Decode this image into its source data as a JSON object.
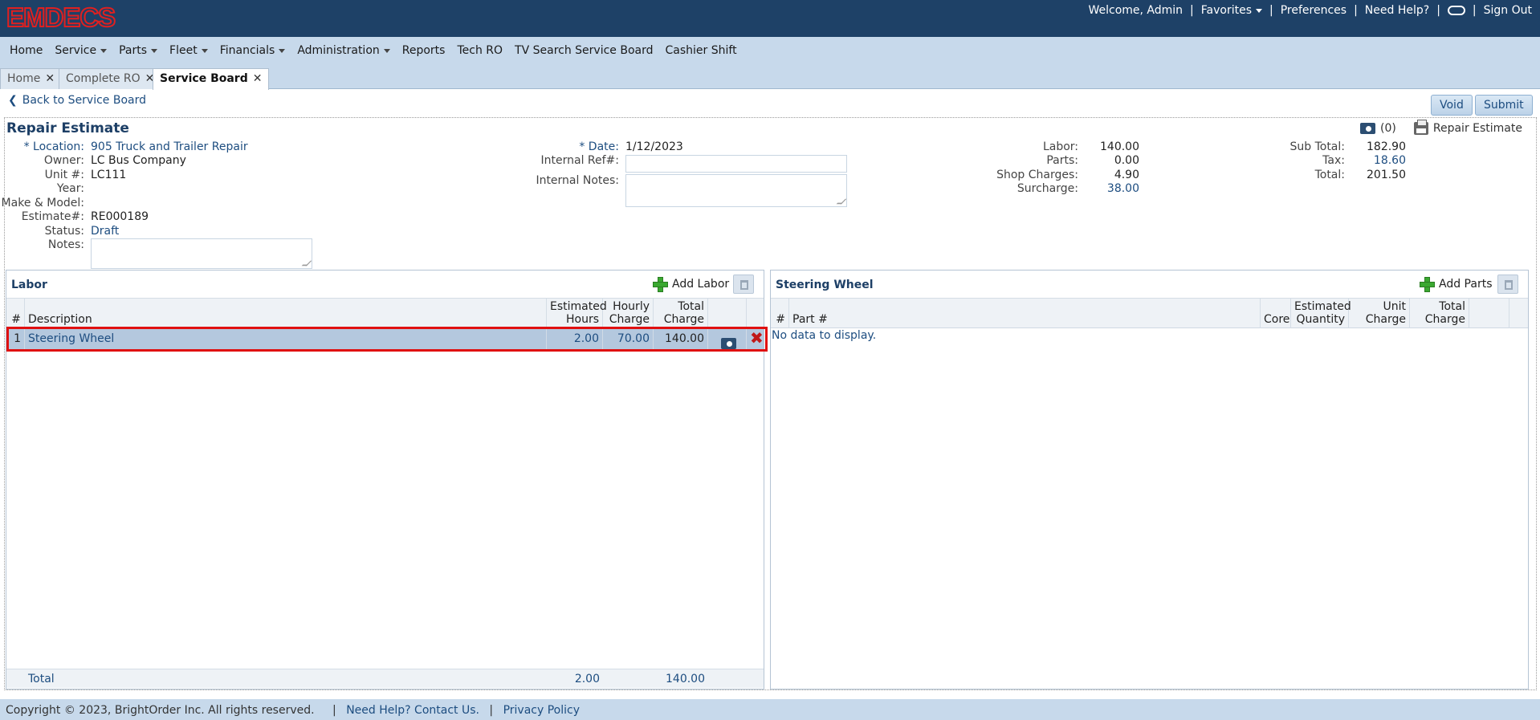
{
  "app": {
    "logo": "EMDECS"
  },
  "topbar": {
    "welcome": "Welcome, Admin",
    "favorites": "Favorites",
    "preferences": "Preferences",
    "need_help": "Need Help?",
    "sign_out": "Sign Out",
    "separator": "|"
  },
  "nav": {
    "items": [
      {
        "label": "Home",
        "dropdown": false
      },
      {
        "label": "Service",
        "dropdown": true
      },
      {
        "label": "Parts",
        "dropdown": true
      },
      {
        "label": "Fleet",
        "dropdown": true
      },
      {
        "label": "Financials",
        "dropdown": true
      },
      {
        "label": "Administration",
        "dropdown": true
      },
      {
        "label": "Reports",
        "dropdown": false
      },
      {
        "label": "Tech RO",
        "dropdown": false
      },
      {
        "label": "TV Search Service Board",
        "dropdown": false
      },
      {
        "label": "Cashier Shift",
        "dropdown": false
      }
    ]
  },
  "tabs": [
    {
      "label": "Home",
      "active": false
    },
    {
      "label": "Complete RO",
      "active": false
    },
    {
      "label": "Service Board",
      "active": true
    }
  ],
  "page": {
    "back_link": "Back to Service Board",
    "void_label": "Void",
    "submit_label": "Submit",
    "title": "Repair Estimate",
    "photo_count": "(0)",
    "print_label": "Repair Estimate"
  },
  "details": {
    "location_label": "* Location:",
    "location": "905 Truck and Trailer Repair",
    "owner_label": "Owner:",
    "owner": "LC Bus Company",
    "unit_label": "Unit #:",
    "unit": "LC111",
    "year_label": "Year:",
    "year": "",
    "make_label": "Make & Model:",
    "make": "",
    "estimate_label": "Estimate#:",
    "estimate": "RE000189",
    "status_label": "Status:",
    "status": "Draft",
    "notes_label": "Notes:",
    "date_label": "* Date:",
    "date": "1/12/2023",
    "internal_ref_label": "Internal Ref#:",
    "internal_ref": "",
    "internal_notes_label": "Internal Notes:"
  },
  "summary": {
    "labor_label": "Labor:",
    "labor": "140.00",
    "parts_label": "Parts:",
    "parts": "0.00",
    "shop_label": "Shop Charges:",
    "shop": "4.90",
    "surcharge_label": "Surcharge:",
    "surcharge": "38.00",
    "subtotal_label": "Sub Total:",
    "subtotal": "182.90",
    "tax_label": "Tax:",
    "tax": "18.60",
    "total_label": "Total:",
    "total": "201.50"
  },
  "labor": {
    "title": "Labor",
    "add_label": "Add Labor",
    "columns": {
      "num": "#",
      "description": "Description",
      "est_hours_1": "Estimated",
      "est_hours_2": "Hours",
      "hourly_1": "Hourly",
      "hourly_2": "Charge",
      "total_1": "Total",
      "total_2": "Charge"
    },
    "rows": [
      {
        "num": "1",
        "description": "Steering Wheel",
        "hours": "2.00",
        "rate": "70.00",
        "total": "140.00"
      }
    ],
    "total_label": "Total",
    "total_hours": "2.00",
    "total_charge": "140.00"
  },
  "parts": {
    "title": "Steering Wheel",
    "add_label": "Add Parts",
    "columns": {
      "num": "#",
      "part": "Part #",
      "core": "Core",
      "qty_1": "Estimated",
      "qty_2": "Quantity",
      "unit_1": "Unit",
      "unit_2": "Charge",
      "total_1": "Total",
      "total_2": "Charge"
    },
    "empty": "No data to display."
  },
  "footer": {
    "copyright": "Copyright © 2023, BrightOrder Inc. All rights reserved.",
    "help": "Need Help? Contact Us.",
    "privacy": "Privacy Policy"
  },
  "colors": {
    "header_bg": "#1e4167",
    "nav_bg": "#c7d9eb",
    "link": "#1d4d80",
    "selected_row": "#b4c8de",
    "highlight": "#e01010"
  }
}
